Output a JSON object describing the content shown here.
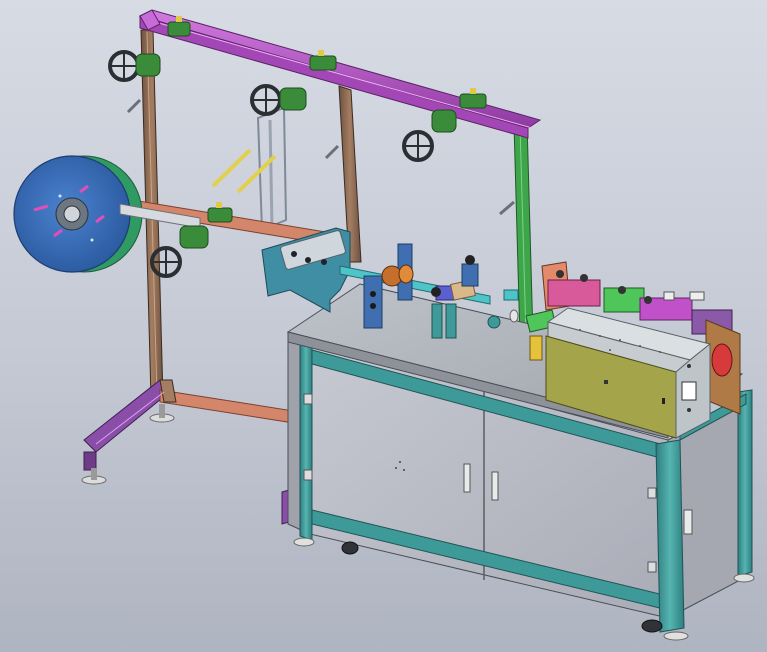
{
  "scene": {
    "subject": "machine",
    "background_gradient": [
      "#d7dbe4",
      "#aeb4c0"
    ]
  },
  "colors": {
    "frame_brown": "#8e6b52",
    "rail_magenta": "#b04fc0",
    "cabinet_panel": "#b9bbc4",
    "cabinet_frame": "#3e9a98",
    "worktop": "#aeb2ba",
    "reel_blue": "#2f65b0",
    "reel_green": "#2f9a62",
    "unit_cover": "#c6cccf",
    "olive_panel": "#a4a44b",
    "hand_wheel": "#2a2f34",
    "bracket_teal": "#3f8ea3",
    "green_post": "#3ea54a",
    "salmon_beam": "#d4866a",
    "purple_base": "#8a4ea8"
  }
}
